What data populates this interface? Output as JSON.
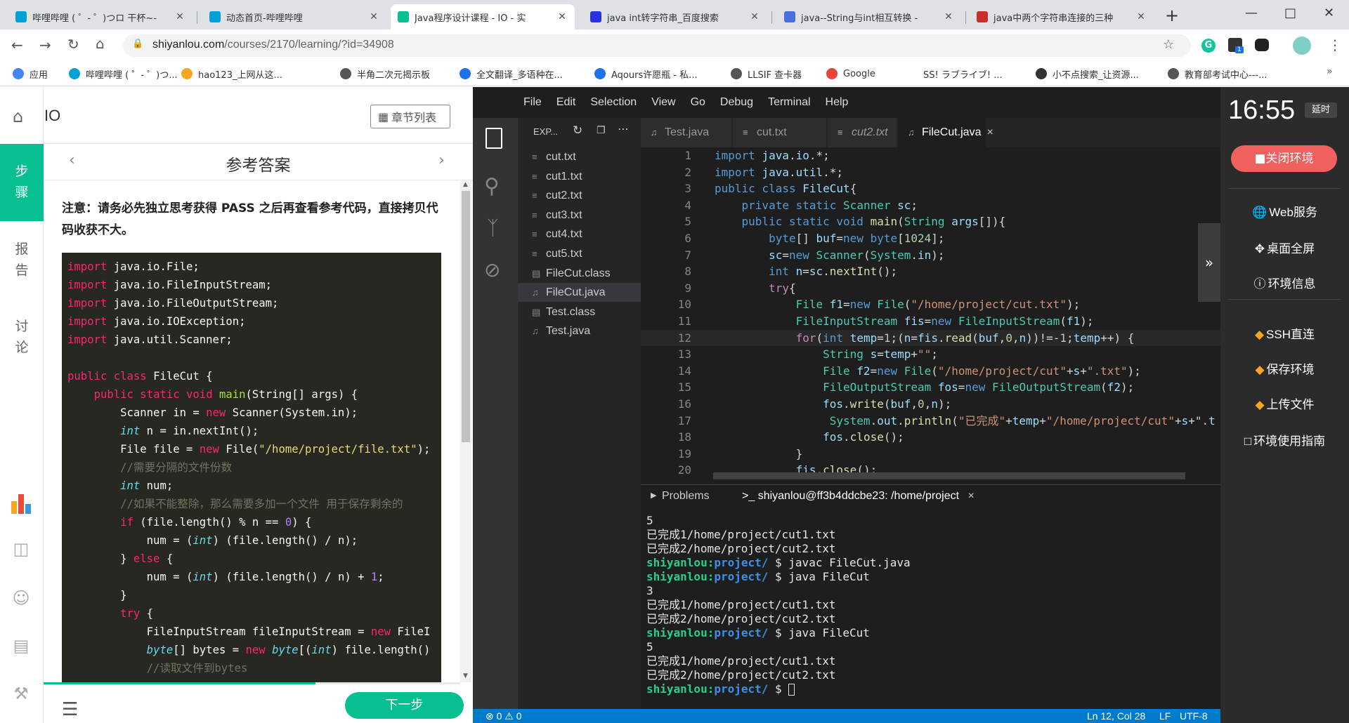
{
  "browser": {
    "tabs": [
      {
        "title": "哔哩哔哩 ( ゜- ゜)つロ 干杯~-",
        "icon_color": "#00a1d6"
      },
      {
        "title": "动态首页-哔哩哔哩",
        "icon_color": "#00a1d6"
      },
      {
        "title": "Java程序设计课程 - IO - 实",
        "icon_color": "#08bf91"
      },
      {
        "title": "java int转字符串_百度搜索",
        "icon_color": "#2932e1"
      },
      {
        "title": "java--String与int相互转换 -",
        "icon_color": "#4a6ee0"
      },
      {
        "title": "java中两个字符串连接的三种",
        "icon_color": "#c9302c"
      }
    ],
    "new_tab": "+",
    "url_host": "shiyanlou.com",
    "url_path": "/courses/2170/learning/?id=34908",
    "bookmarks": [
      {
        "label": "应用"
      },
      {
        "label": "哔哩哔哩 ( ゜- ゜)つ..."
      },
      {
        "label": "hao123_上网从这..."
      },
      {
        "label": "半角二次元揭示板"
      },
      {
        "label": "全文翻译_多语种在..."
      },
      {
        "label": "Aqours许愿瓶 - 私..."
      },
      {
        "label": "LLSIF 查卡器"
      },
      {
        "label": "Google"
      },
      {
        "label": "SS! ラブライブ! ..."
      },
      {
        "label": "小不点搜索_让资源..."
      },
      {
        "label": "教育部考试中心---..."
      }
    ],
    "ext_badge": "1"
  },
  "lesson": {
    "home_title": "IO",
    "chapter_list": "章节列表",
    "section_title": "参考答案",
    "side_tabs": [
      "步骤",
      "报告",
      "讨论"
    ],
    "notice": "注意：请务必先独立思考获得 PASS 之后再查看参考代码，直接拷贝代码收获不大。",
    "next_button": "下一步",
    "code_lines": [
      "import java.io.File;",
      "import java.io.FileInputStream;",
      "import java.io.FileOutputStream;",
      "import java.io.IOException;",
      "import java.util.Scanner;",
      "",
      "public class FileCut {",
      "    public static void main(String[] args) {",
      "        Scanner in = new Scanner(System.in);",
      "        int n = in.nextInt();",
      "        File file = new File(\"/home/project/file.txt\");",
      "        //需要分隔的文件份数",
      "        int num;",
      "        //如果不能整除，那么需要多加一个文件 用于保存剩余的",
      "        if (file.length() % n == 0) {",
      "            num = (int) (file.length() / n);",
      "        } else {",
      "            num = (int) (file.length() / n) + 1;",
      "        }",
      "        try {",
      "            FileInputStream fileInputStream = new FileI",
      "            byte[] bytes = new byte[(int) file.length()",
      "            //读取文件到bytes"
    ]
  },
  "vscode": {
    "menu": [
      "File",
      "Edit",
      "Selection",
      "View",
      "Go",
      "Debug",
      "Terminal",
      "Help"
    ],
    "explorer_title": "EXP...",
    "files": [
      "cut.txt",
      "cut1.txt",
      "cut2.txt",
      "cut3.txt",
      "cut4.txt",
      "cut5.txt",
      "FileCut.class",
      "FileCut.java",
      "Test.class",
      "Test.java"
    ],
    "selected_file": "FileCut.java",
    "editor_tabs": [
      "Test.java",
      "cut.txt",
      "cut2.txt",
      "FileCut.java"
    ],
    "active_tab": "FileCut.java",
    "close_glyph": "×",
    "line_numbers": [
      "1",
      "2",
      "3",
      "4",
      "5",
      "6",
      "7",
      "8",
      "9",
      "10",
      "11",
      "12",
      "13",
      "14",
      "15",
      "16",
      "17",
      "18",
      "19",
      "20"
    ],
    "code_lines": [
      "import java.io.*;",
      "import java.util.*;",
      "public class FileCut{",
      "    private static Scanner sc;",
      "    public static void main(String args[]){",
      "        byte[] buf=new byte[1024];",
      "        sc=new Scanner(System.in);",
      "        int n=sc.nextInt();",
      "        try{",
      "            File f1=new File(\"/home/project/cut.txt\");",
      "            FileInputStream fis=new FileInputStream(f1);",
      "            for(int temp=1;(n=fis.read(buf,0,n))!=-1;temp++) {",
      "                String s=temp+\"\";",
      "                File f2=new File(\"/home/project/cut\"+s+\".txt\");",
      "                FileOutputStream fos=new FileOutputStream(f2);",
      "                fos.write(buf,0,n);",
      "                 System.out.println(\"已完成\"+temp+\"/home/project/cut\"+s+\".t",
      "                fos.close();",
      "            }",
      "            fis.close();"
    ],
    "panel_tabs": {
      "problems": "Problems",
      "terminal": "shiyanlou@ff3b4ddcbe23: /home/project"
    },
    "terminal_lines": [
      {
        "text": "5"
      },
      {
        "text": "已完成1/home/project/cut1.txt"
      },
      {
        "text": "已完成2/home/project/cut2.txt"
      },
      {
        "user": "shiyanlou:",
        "dir": "project/",
        "cmd": " $ javac FileCut.java"
      },
      {
        "user": "shiyanlou:",
        "dir": "project/",
        "cmd": " $ java FileCut"
      },
      {
        "text": "3"
      },
      {
        "text": "已完成1/home/project/cut1.txt"
      },
      {
        "text": "已完成2/home/project/cut2.txt"
      },
      {
        "user": "shiyanlou:",
        "dir": "project/",
        "cmd": " $ java FileCut"
      },
      {
        "text": "5"
      },
      {
        "text": "已完成1/home/project/cut1.txt"
      },
      {
        "text": "已完成2/home/project/cut2.txt"
      },
      {
        "user": "shiyanlou:",
        "dir": "project/",
        "cmd": " $ "
      }
    ],
    "status_errors": "0",
    "status_warnings": "0",
    "status_position": "Ln 12, Col 28",
    "status_eol": "LF",
    "status_encoding": "UTF-8"
  },
  "env_sidebar": {
    "clock": "16:55",
    "extend_label": "延时",
    "close_env": "关闭环境",
    "items": [
      "Web服务",
      "桌面全屏",
      "环境信息",
      "SSH直连",
      "保存环境",
      "上传文件",
      "环境使用指南"
    ]
  }
}
